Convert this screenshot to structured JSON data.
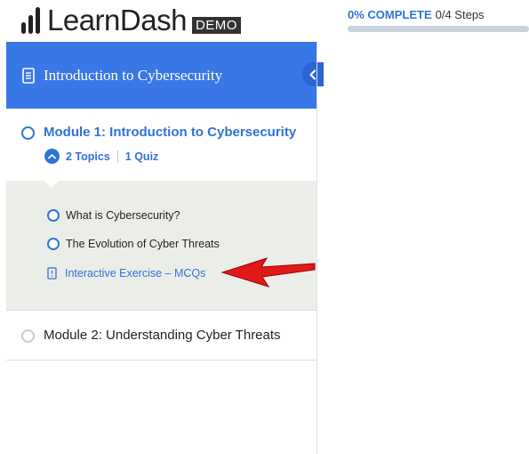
{
  "header": {
    "logo_text": "LearnDash",
    "logo_badge": "DEMO",
    "progress_percent_label": "0% COMPLETE",
    "progress_steps_label": "0/4 Steps",
    "progress_value": 0
  },
  "sidebar": {
    "course_title": "Introduction to Cybersecurity",
    "modules": [
      {
        "title": "Module 1: Introduction to Cybersecurity",
        "topics_count_label": "2 Topics",
        "quiz_count_label": "1 Quiz",
        "expanded": true,
        "items": [
          {
            "label": "What is Cybersecurity?",
            "type": "topic"
          },
          {
            "label": "The Evolution of Cyber Threats",
            "type": "topic"
          },
          {
            "label": "Interactive Exercise – MCQs",
            "type": "quiz"
          }
        ]
      },
      {
        "title": "Module 2: Understanding Cyber Threats"
      }
    ]
  },
  "colors": {
    "accent": "#3172d6",
    "header_bg": "#3a77e6",
    "panel_bg": "#ebeee8",
    "arrow": "#e01818"
  },
  "icons": {
    "logo": "bar-chart-icon",
    "course": "document-icon",
    "collapse": "chevron-left-icon",
    "expand": "chevron-up-icon",
    "quiz": "quiz-icon",
    "annotation": "red-arrow-icon"
  }
}
